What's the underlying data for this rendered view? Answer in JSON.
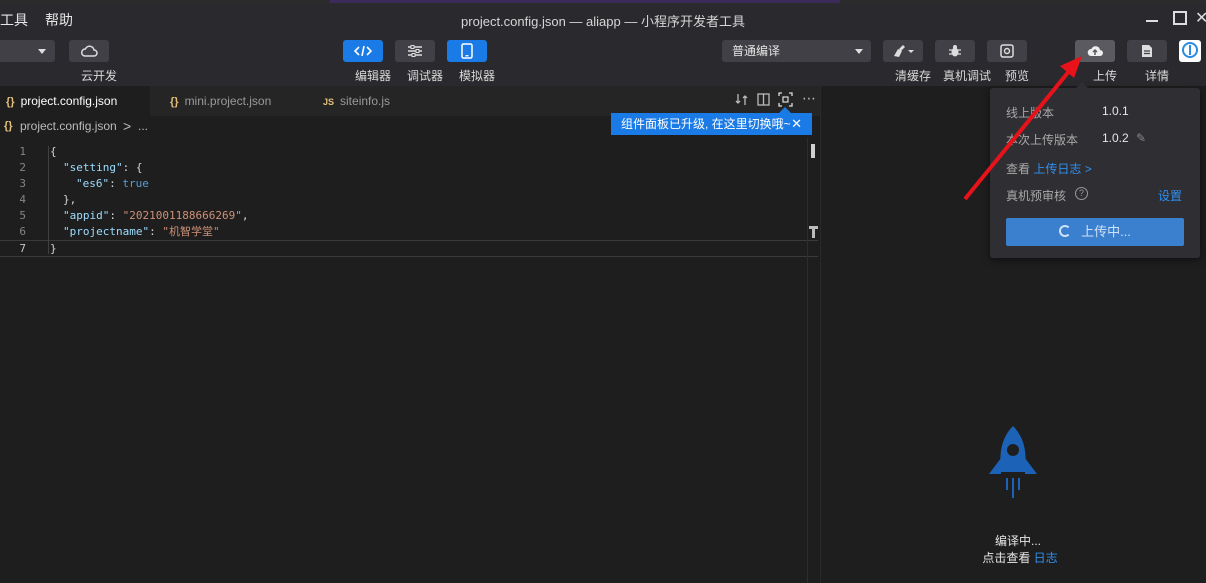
{
  "menu": {
    "tools": "工具",
    "help": "帮助"
  },
  "window": {
    "title": "project.config.json — aliapp — 小程序开发者工具"
  },
  "toolbar": {
    "cloud_dev": "云开发",
    "editor": "编辑器",
    "debugger": "调试器",
    "simulator": "模拟器",
    "compile_mode": "普通编译",
    "clear_cache": "清缓存",
    "device_debug": "真机调试",
    "preview": "预览",
    "upload": "上传",
    "details": "详情"
  },
  "tabs": [
    {
      "icon": "{}",
      "label": "project.config.json"
    },
    {
      "icon": "{}",
      "label": "mini.project.json"
    },
    {
      "icon": "JS",
      "label": "siteinfo.js"
    }
  ],
  "breadcrumb": {
    "icon": "{}",
    "file": "project.config.json",
    "sep": ">",
    "more": "..."
  },
  "editor": {
    "line_numbers": [
      "1",
      "2",
      "3",
      "4",
      "5",
      "6",
      "7"
    ],
    "lines": [
      {
        "key": "",
        "value": "{"
      },
      {
        "key": "\"setting\"",
        "value": ": {"
      },
      {
        "key": "\"es6\"",
        "value": "true"
      },
      {
        "key": "",
        "value": "},"
      },
      {
        "key": "\"appid\"",
        "value": "\"2021001188666269\""
      },
      {
        "key": "\"projectname\"",
        "value": "\"机智学堂\""
      },
      {
        "key": "",
        "value": "}"
      }
    ]
  },
  "tooltip": {
    "text": "组件面板已升级, 在这里切换哦~",
    "close": "✕"
  },
  "upload_popup": {
    "online_label": "线上版本",
    "online_value": "1.0.1",
    "this_label": "本次上传版本",
    "this_value": "1.0.2",
    "view_label": "查看",
    "log_link": "上传日志 >",
    "precheck_label": "真机预审核",
    "precheck_help": "?",
    "settings_link": "设置",
    "uploading_button": "上传中..."
  },
  "simulator": {
    "status": "编译中...",
    "view_prefix": "点击查看",
    "log_link": "日志"
  },
  "colors": {
    "accent": "#1a7ae6",
    "annotation_arrow": "#e8121a"
  },
  "icons": [
    "cloud-icon",
    "code-icon",
    "sliders-icon",
    "phone-icon",
    "brush-icon",
    "bug-icon",
    "preview-icon",
    "cloud-upload-icon",
    "document-icon",
    "rocket-icon"
  ]
}
